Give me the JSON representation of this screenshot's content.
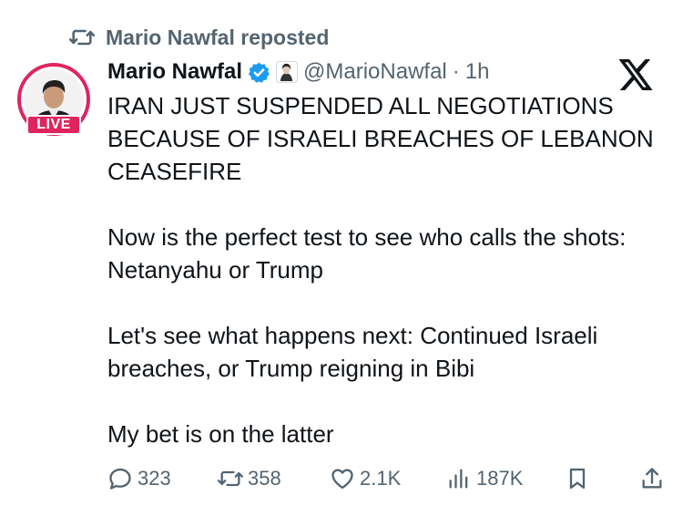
{
  "repost": {
    "text": "Mario Nawfal reposted"
  },
  "author": {
    "name": "Mario Nawfal",
    "handle": "@MarioNawfal",
    "separator": "·",
    "time": "1h",
    "live_badge": "LIVE",
    "verified_color": "#1d9bf0"
  },
  "tweet": {
    "paragraphs": [
      "IRAN JUST SUSPENDED ALL NEGOTIATIONS BECAUSE OF ISRAELI BREACHES OF LEBANON CEASEFIRE",
      "Now is the perfect test to see who calls the shots: Netanyahu or Trump",
      "Let's see what happens next: Continued Israeli breaches, or Trump reigning in Bibi",
      "My bet is on the latter"
    ]
  },
  "actions": {
    "replies": "323",
    "reposts": "358",
    "likes": "2.1K",
    "views": "187K"
  },
  "icons": {
    "repost": "repost-icon",
    "reply": "reply-icon",
    "like": "heart-icon",
    "views": "views-chart-icon",
    "bookmark": "bookmark-icon",
    "share": "share-icon",
    "brand": "x-logo-icon"
  },
  "colors": {
    "text": "#0f1419",
    "secondary": "#536471",
    "live": "#e0245e",
    "verified": "#1d9bf0"
  }
}
